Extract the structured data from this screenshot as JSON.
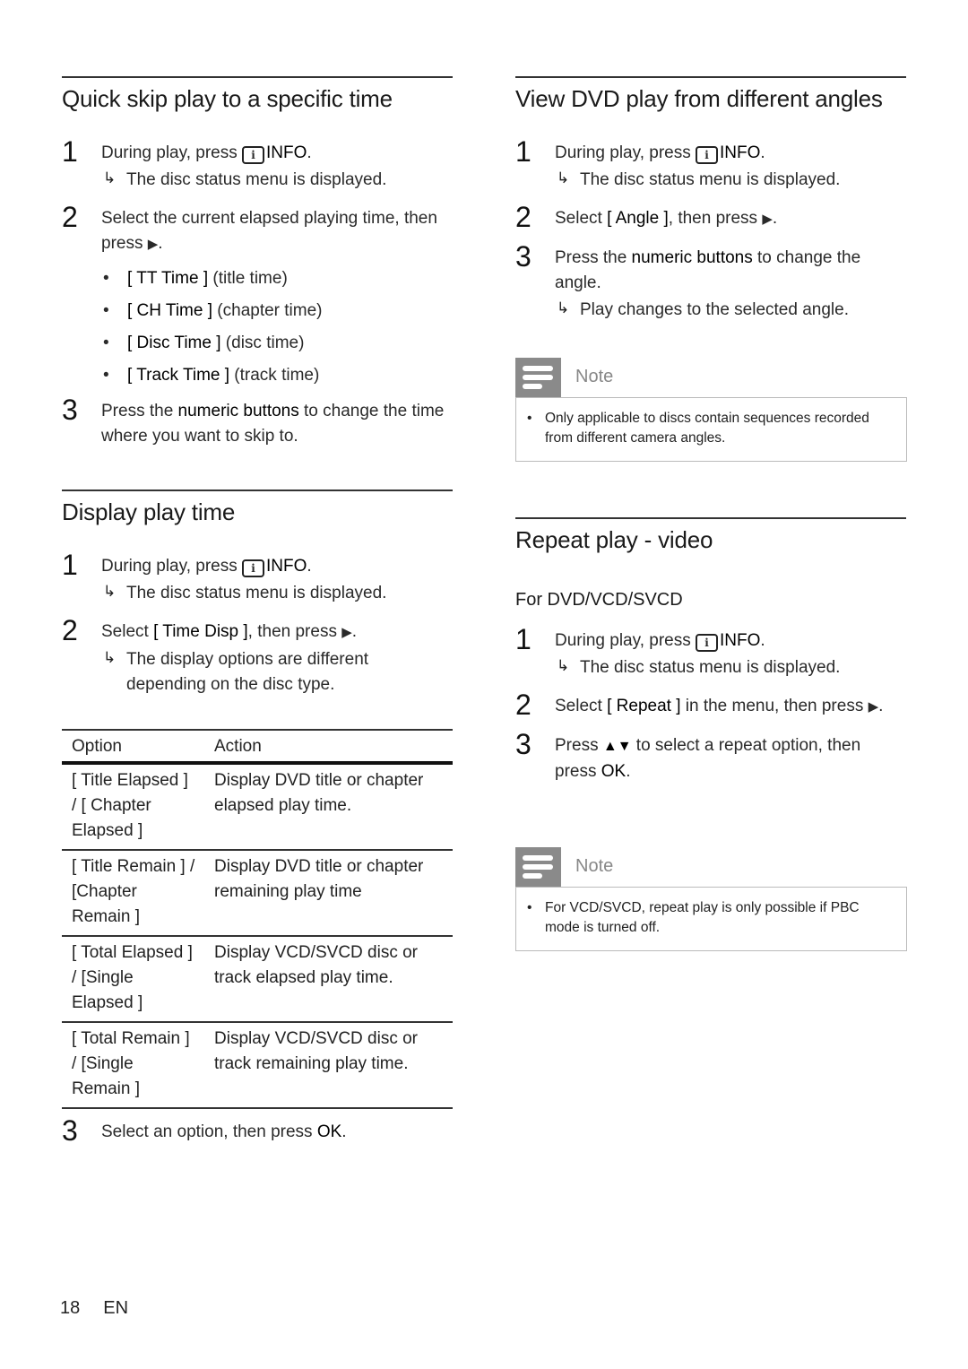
{
  "left": {
    "quick_skip": {
      "title": "Quick skip play to a specific time",
      "steps": [
        {
          "num": "1",
          "pre": "During play, press ",
          "key": "INFO",
          "post": ".",
          "result": "The disc status menu is displayed."
        },
        {
          "num": "2",
          "text": "Select the current elapsed playing time, then press ",
          "tail": "."
        },
        {
          "num": "3",
          "pre": "Press the ",
          "bold": "numeric buttons",
          "post": " to change the time where you want to skip to."
        }
      ],
      "options": [
        {
          "label": "[ TT Time ]",
          "desc": " (title time)"
        },
        {
          "label": "[ CH Time ]",
          "desc": " (chapter time)"
        },
        {
          "label": "[ Disc Time ]",
          "desc": " (disc time)"
        },
        {
          "label": "[ Track Time ]",
          "desc": " (track time)"
        }
      ]
    },
    "display_time": {
      "title": "Display play time",
      "steps": [
        {
          "num": "1",
          "pre": "During play, press ",
          "key": "INFO",
          "post": ".",
          "result": "The disc status menu is displayed."
        },
        {
          "num": "2",
          "pre": "Select ",
          "bold": "[ Time Disp ]",
          "post": ", then press ",
          "tail": ".",
          "result": "The display options are different depending on the disc type."
        },
        {
          "num": "3",
          "pre": "Select an option, then press ",
          "key": "OK",
          "post": "."
        }
      ],
      "table": {
        "headers": [
          "Option",
          "Action"
        ],
        "rows": [
          {
            "option": "[ Title Elapsed ] / [ Chapter Elapsed ]",
            "action": "Display DVD title or chapter elapsed play time."
          },
          {
            "option": "[ Title Remain ] / [Chapter Remain ]",
            "action": "Display DVD title or chapter remaining play time"
          },
          {
            "option": "[ Total Elapsed ] / [Single Elapsed ]",
            "action": "Display VCD/SVCD disc or track elapsed play time."
          },
          {
            "option": "[ Total Remain ] / [Single Remain ]",
            "action": "Display VCD/SVCD disc or track remaining play time."
          }
        ]
      }
    }
  },
  "right": {
    "angles": {
      "title": "View DVD play from different angles",
      "steps": [
        {
          "num": "1",
          "pre": "During play, press ",
          "key": "INFO",
          "post": ".",
          "result": "The disc status menu is displayed."
        },
        {
          "num": "2",
          "pre": "Select ",
          "bold": "[ Angle ]",
          "post": ", then press ",
          "tail": "."
        },
        {
          "num": "3",
          "pre": "Press the ",
          "bold": "numeric buttons",
          "post": " to change the angle.",
          "result": "Play changes to the selected angle."
        }
      ],
      "note": {
        "label": "Note",
        "text": "Only applicable to discs contain sequences recorded from different camera angles."
      }
    },
    "repeat": {
      "title": "Repeat play - video",
      "subhead": "For DVD/VCD/SVCD",
      "steps": [
        {
          "num": "1",
          "pre": "During play, press ",
          "key": "INFO",
          "post": ".",
          "result": "The disc status menu is displayed."
        },
        {
          "num": "2",
          "pre": "Select ",
          "bold": "[ Repeat ]",
          "post": " in the menu, then press ",
          "tail": "."
        },
        {
          "num": "3",
          "pre": "Press ",
          "keys": "▲▼",
          "post": " to select a repeat option, then press ",
          "key": "OK",
          "tail": "."
        }
      ],
      "note": {
        "label": "Note",
        "text": "For VCD/SVCD, repeat play is only possible if PBC mode is turned off."
      }
    }
  },
  "footer": {
    "page": "18",
    "lang": "EN"
  },
  "icons": {
    "info": "i",
    "play": "▶",
    "result_arrow": "↳"
  }
}
